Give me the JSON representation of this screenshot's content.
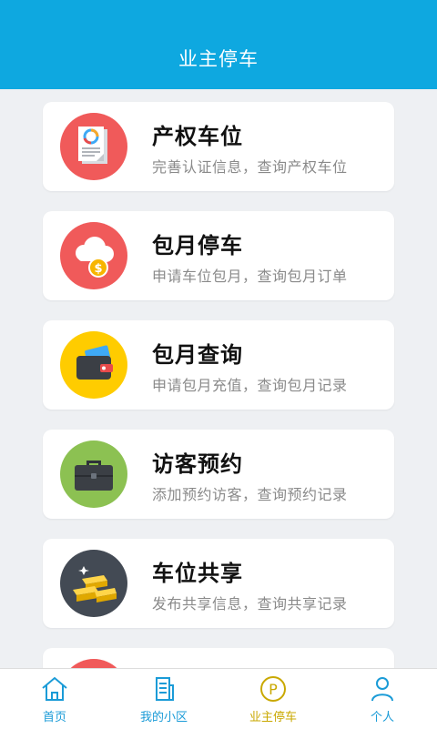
{
  "header": {
    "title": "业主停车"
  },
  "cards": [
    {
      "title": "产权车位",
      "subtitle": "完善认证信息，查询产权车位",
      "icon": "document-chart-icon",
      "color": "#f05a5a"
    },
    {
      "title": "包月停车",
      "subtitle": "申请车位包月，查询包月订单",
      "icon": "cloud-coin-icon",
      "color": "#f05a5a"
    },
    {
      "title": "包月查询",
      "subtitle": "申请包月充值，查询包月记录",
      "icon": "wallet-icon",
      "color": "#ffcc00"
    },
    {
      "title": "访客预约",
      "subtitle": "添加预约访客，查询预约记录",
      "icon": "briefcase-icon",
      "color": "#8cc152"
    },
    {
      "title": "车位共享",
      "subtitle": "发布共享信息，查询共享记录",
      "icon": "gold-bars-icon",
      "color": "#434a54"
    }
  ],
  "tabs": [
    {
      "label": "首页",
      "icon": "home-icon"
    },
    {
      "label": "我的小区",
      "icon": "building-icon"
    },
    {
      "label": "业主停车",
      "icon": "parking-icon",
      "active": true
    },
    {
      "label": "个人",
      "icon": "person-icon"
    }
  ],
  "colors": {
    "header": "#0ea8e0",
    "tab": "#1a9bd7",
    "tab_active": "#c9a800"
  }
}
